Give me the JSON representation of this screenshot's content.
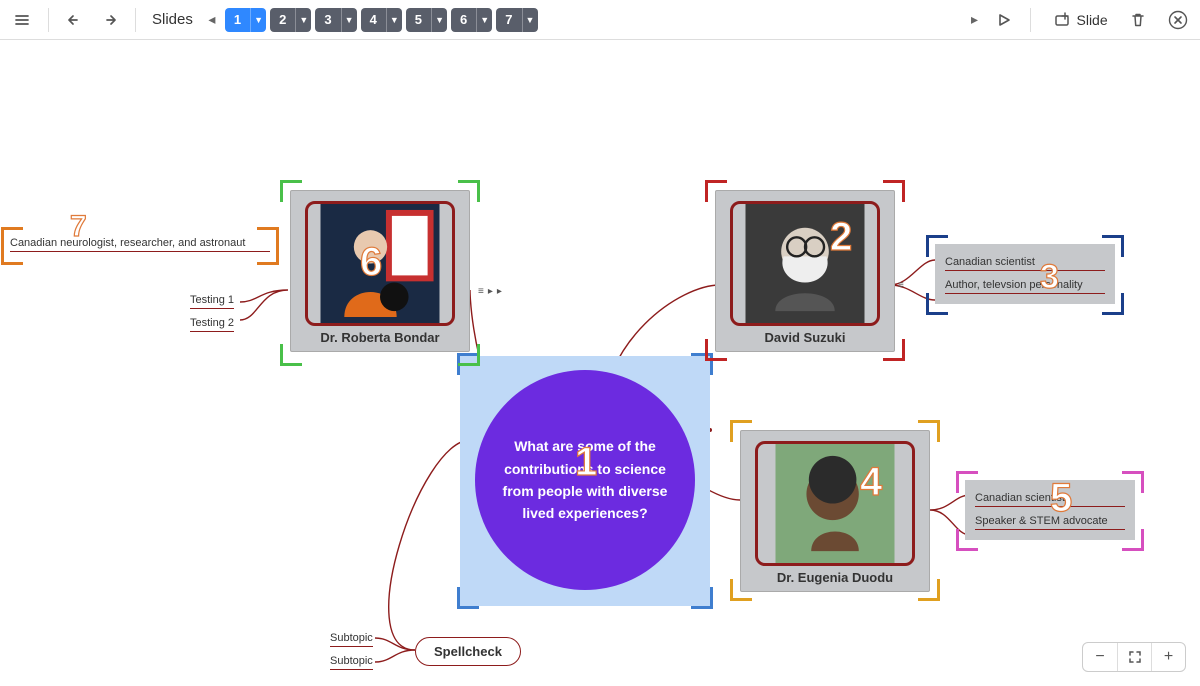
{
  "toolbar": {
    "slides_label": "Slides",
    "slide_numbers": [
      "1",
      "2",
      "3",
      "4",
      "5",
      "6",
      "7"
    ],
    "active_slide": 0,
    "add_slide_label": "Slide"
  },
  "central": {
    "question": "What are some of the contributions to science from people with diverse lived experiences?",
    "number": "1"
  },
  "suzuki": {
    "name": "David Suzuki",
    "number": "2",
    "details": {
      "number": "3",
      "lines": [
        "Canadian scientist",
        "Author, televsion personality"
      ]
    }
  },
  "duodu": {
    "name": "Dr. Eugenia Duodu",
    "number": "4",
    "details": {
      "number": "5",
      "lines": [
        "Canadian scientist",
        "Speaker & STEM advocate"
      ]
    }
  },
  "bondar": {
    "name": "Dr. Roberta Bondar",
    "number": "6",
    "details": {
      "number": "7",
      "line": "Canadian neurologist, researcher, and astronaut"
    },
    "testing": [
      "Testing 1",
      "Testing 2"
    ]
  },
  "spellcheck": {
    "label": "Spellcheck",
    "subtopics": [
      "Subtopic",
      "Subtopic"
    ]
  },
  "frame_colors": {
    "central": "#3f7ecf",
    "suzuki_card": "#c02424",
    "suzuki_details": "#1b3f8a",
    "duodu_card": "#e0a020",
    "duodu_details": "#d64fbf",
    "bondar_card": "#49c049",
    "bondar_details": "#e07a20"
  }
}
